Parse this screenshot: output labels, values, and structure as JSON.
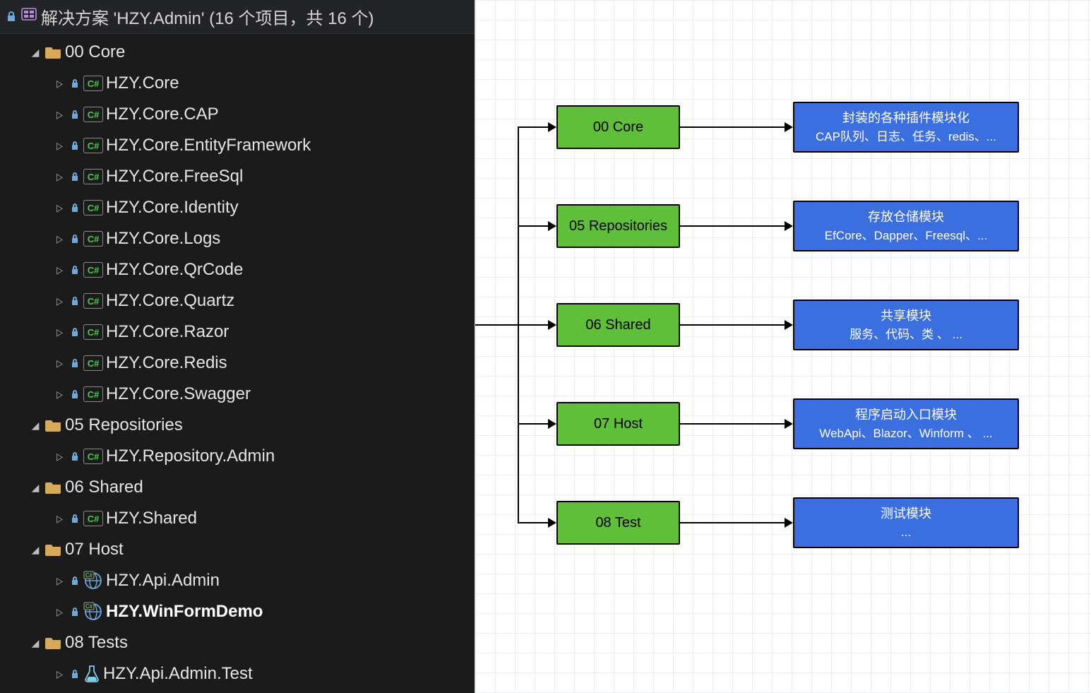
{
  "solution": {
    "title": "解决方案 'HZY.Admin' (16 个项目，共 16 个)",
    "folders": [
      {
        "name": "00 Core",
        "open": true,
        "items": [
          {
            "label": "HZY.Core",
            "type": "csproj"
          },
          {
            "label": "HZY.Core.CAP",
            "type": "csproj"
          },
          {
            "label": "HZY.Core.EntityFramework",
            "type": "csproj"
          },
          {
            "label": "HZY.Core.FreeSql",
            "type": "csproj"
          },
          {
            "label": "HZY.Core.Identity",
            "type": "csproj"
          },
          {
            "label": "HZY.Core.Logs",
            "type": "csproj"
          },
          {
            "label": "HZY.Core.QrCode",
            "type": "csproj"
          },
          {
            "label": "HZY.Core.Quartz",
            "type": "csproj"
          },
          {
            "label": "HZY.Core.Razor",
            "type": "csproj"
          },
          {
            "label": "HZY.Core.Redis",
            "type": "csproj"
          },
          {
            "label": "HZY.Core.Swagger",
            "type": "csproj"
          }
        ]
      },
      {
        "name": "05 Repositories",
        "open": true,
        "items": [
          {
            "label": "HZY.Repository.Admin",
            "type": "csproj"
          }
        ]
      },
      {
        "name": "06 Shared",
        "open": true,
        "items": [
          {
            "label": "HZY.Shared",
            "type": "csproj"
          }
        ]
      },
      {
        "name": "07 Host",
        "open": true,
        "items": [
          {
            "label": "HZY.Api.Admin",
            "type": "web"
          },
          {
            "label": "HZY.WinFormDemo",
            "type": "web",
            "bold": true
          }
        ]
      },
      {
        "name": "08 Tests",
        "open": true,
        "items": [
          {
            "label": "HZY.Api.Admin.Test",
            "type": "test"
          }
        ]
      }
    ]
  },
  "diagram": {
    "rows": [
      {
        "green": "00 Core",
        "blue_l1": "封装的各种插件模块化",
        "blue_l2": "CAP队列、日志、任务、redis、..."
      },
      {
        "green": "05 Repositories",
        "blue_l1": "存放仓储模块",
        "blue_l2": "EfCore、Dapper、Freesql、..."
      },
      {
        "green": "06 Shared",
        "blue_l1": "共享模块",
        "blue_l2": "服务、代码、类 、 ..."
      },
      {
        "green": "07 Host",
        "blue_l1": "程序启动入口模块",
        "blue_l2": "WebApi、Blazor、Winform 、 ..."
      },
      {
        "green": "08 Test",
        "blue_l1": "测试模块",
        "blue_l2": "..."
      }
    ]
  }
}
